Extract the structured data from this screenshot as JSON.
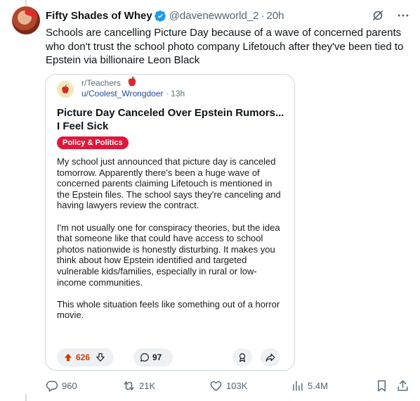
{
  "tweet": {
    "display_name": "Fifty Shades of Whey",
    "handle": "@davenewworld_2",
    "separator": "·",
    "time": "20h",
    "text": "Schools are cancelling Picture Day because of a wave of concerned parents who don't trust the school photo company Lifetouch after they've been tied to Epstein via billionaire Leon Black"
  },
  "card": {
    "subreddit": "r/Teachers",
    "username": "u/Coolest_Wrongdoer",
    "time": "· 13h",
    "title": "Picture Day Canceled Over Epstein Rumors... I Feel Sick",
    "flair": "Policy & Politics",
    "paragraphs": [
      "My school just announced that picture day is canceled tomorrow. Apparently there's been a huge wave of concerned parents claiming Lifetouch is mentioned in the Epstein files. The school says they're canceling and having lawyers review the contract.",
      "I'm not usually one for conspiracy theories, but the idea that someone like that could have access to school photos nationwide is honestly disturbing. It makes you think about how Epstein identified and targeted vulnerable kids/families, especially in rural or low-income communities.",
      "This whole situation feels like something out of a horror movie."
    ],
    "votes": "626",
    "comments": "97"
  },
  "footer": {
    "replies": "960",
    "reposts": "21K",
    "likes": "103K",
    "views": "5.4M"
  },
  "icons": [
    "grok-icon",
    "more-icon",
    "verified-icon",
    "apple-icon",
    "upvote-icon",
    "downvote-icon",
    "comment-icon",
    "award-icon",
    "share-icon",
    "reply-icon",
    "repost-icon",
    "like-icon",
    "views-icon",
    "bookmark-icon",
    "share-icon"
  ],
  "colors": {
    "verified": "#1d9bf0",
    "flair": "#e0163a",
    "upvote": "#d93a00",
    "muted": "#536471"
  }
}
